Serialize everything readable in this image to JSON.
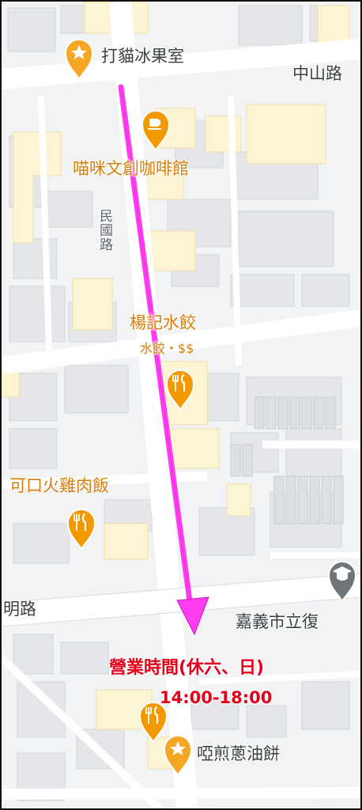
{
  "map": {
    "places": {
      "fruit_shop": {
        "name": "打貓冰果室",
        "icon": "star-pin-icon"
      },
      "cafe": {
        "name": "喵咪文創咖啡館",
        "icon": "coffee-pin-icon"
      },
      "dumplings": {
        "name": "楊記水餃",
        "category": "水餃・$$",
        "icon": "restaurant-pin-icon"
      },
      "turkey_rice": {
        "name": "可口火雞肉飯",
        "icon": "restaurant-pin-icon"
      },
      "school": {
        "name": "嘉義市立復",
        "icon": "school-pin-icon"
      },
      "scallion_pancake": {
        "name": "啞煎蔥油餅",
        "icon": "star-pin-icon"
      },
      "unnamed_restaurant": {
        "icon": "restaurant-pin-icon"
      }
    },
    "roads": {
      "zhongshan": "中山路",
      "minguo": "民國路",
      "left_road": "明路"
    },
    "route": {
      "color": "#ff3cf0"
    },
    "annotation": {
      "line1": "營業時間(休六、日)",
      "line2": "14:00-18:00",
      "color": "#e3001b"
    },
    "colors": {
      "poi_orange": "#d87e08",
      "building_yellow": "#fdf4d4",
      "road": "#ffffff"
    }
  }
}
